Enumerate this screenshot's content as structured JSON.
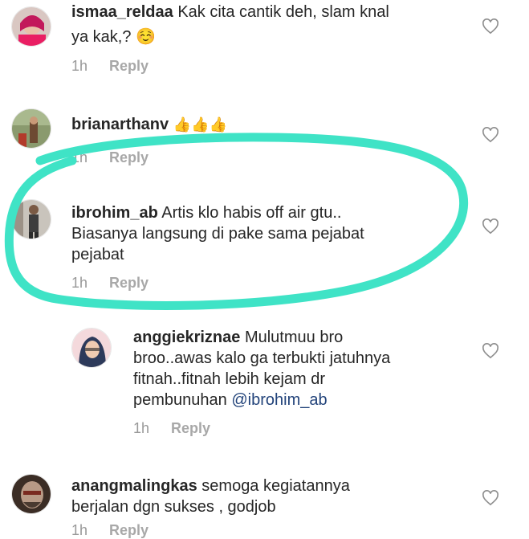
{
  "comments": [
    {
      "username": "ismaa_reldaa",
      "lines": [
        "Kak cita cantik deh, slam knal",
        "ya kak,? ☺️"
      ],
      "time": "1h",
      "reply_label": "Reply"
    },
    {
      "username": "brianarthanv",
      "lines": [
        "👍👍👍"
      ],
      "time": "1h",
      "reply_label": "Reply"
    },
    {
      "username": "ibrohim_ab",
      "lines": [
        "Artis klo habis off air gtu..",
        "Biasanya langsung di pake sama pejabat",
        "pejabat"
      ],
      "time": "1h",
      "reply_label": "Reply"
    },
    {
      "username": "anggiekriznae",
      "lines": [
        "Mulutmuu bro",
        "broo..awas kalo ga terbukti jatuhnya",
        "fitnah..fitnah lebih kejam dr",
        "pembunuhan"
      ],
      "mention": "@ibrohim_ab",
      "time": "1h",
      "reply_label": "Reply"
    },
    {
      "username": "anangmalingkas",
      "lines": [
        "semoga kegiatannya",
        "berjalan dgn sukses , godjob"
      ],
      "time": "1h",
      "reply_label": "Reply"
    }
  ],
  "colors": {
    "annotation_circle": "#3fe3c6",
    "text": "#262626",
    "meta": "#999999",
    "mention": "#22437a"
  },
  "icons": {
    "like": "heart-outline-icon"
  }
}
